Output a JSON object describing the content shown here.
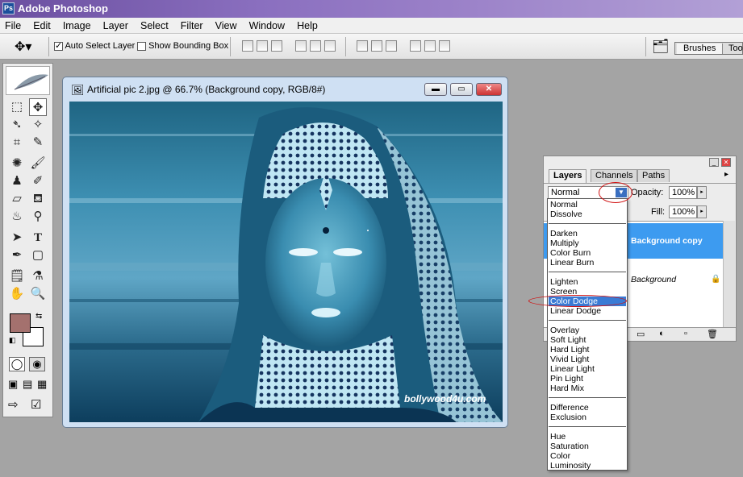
{
  "app": {
    "title": "Adobe Photoshop",
    "icon_text": "Ps"
  },
  "menu": [
    "File",
    "Edit",
    "Image",
    "Layer",
    "Select",
    "Filter",
    "View",
    "Window",
    "Help"
  ],
  "options": {
    "auto_select_label": "Auto Select Layer",
    "auto_select_checked": true,
    "show_bounding_label": "Show Bounding Box",
    "show_bounding_checked": false,
    "tabs": [
      "Brushes",
      "Too"
    ]
  },
  "document": {
    "title": "Artificial pic 2.jpg @ 66.7% (Background copy, RGB/8#)",
    "watermark": "bollywood4u.com"
  },
  "layers_panel": {
    "tabs": [
      "Layers",
      "Channels",
      "Paths"
    ],
    "blend_mode": "Normal",
    "opacity_label": "Opacity:",
    "opacity_value": "100%",
    "fill_label": "Fill:",
    "fill_value": "100%",
    "layers": [
      {
        "name": "Background copy",
        "selected": true
      },
      {
        "name": "Background",
        "locked": true
      }
    ]
  },
  "blend_menu": {
    "groups": [
      [
        "Normal",
        "Dissolve"
      ],
      [
        "Darken",
        "Multiply",
        "Color Burn",
        "Linear Burn"
      ],
      [
        "Lighten",
        "Screen",
        "Color Dodge",
        "Linear Dodge"
      ],
      [
        "Overlay",
        "Soft Light",
        "Hard Light",
        "Vivid Light",
        "Linear Light",
        "Pin Light",
        "Hard Mix"
      ],
      [
        "Difference",
        "Exclusion"
      ],
      [
        "Hue",
        "Saturation",
        "Color",
        "Luminosity"
      ]
    ],
    "selected": "Color Dodge"
  },
  "colors": {
    "foreground": "#a4716e",
    "background": "#ffffff",
    "accent": "#3a7bd5",
    "annotation": "#d01010"
  }
}
